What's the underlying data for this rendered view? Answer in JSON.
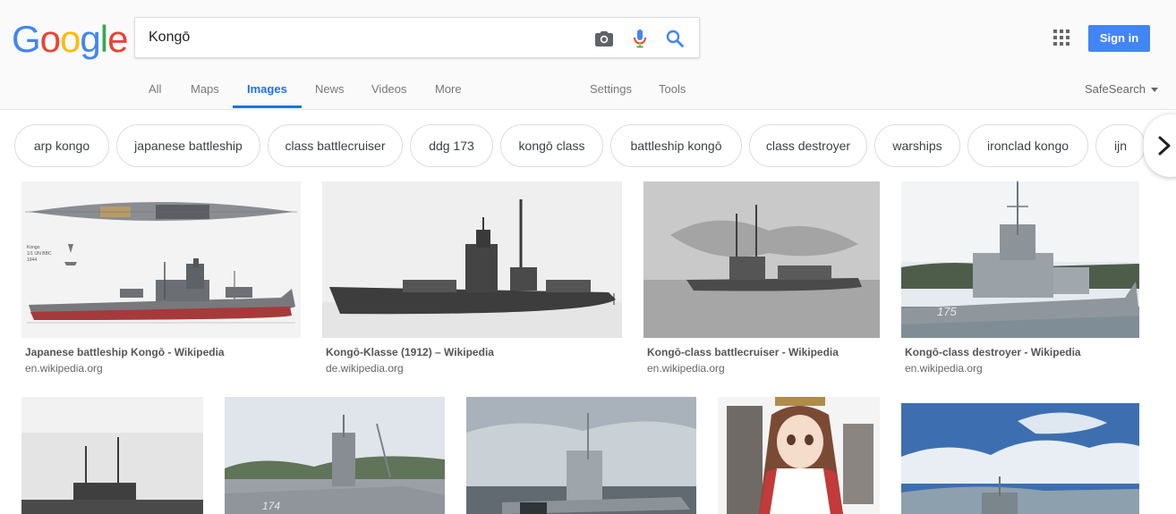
{
  "search": {
    "query": "Kongō"
  },
  "auth": {
    "sign_in_label": "Sign in"
  },
  "nav": {
    "tabs": [
      {
        "label": "All"
      },
      {
        "label": "Maps"
      },
      {
        "label": "Images"
      },
      {
        "label": "News"
      },
      {
        "label": "Videos"
      },
      {
        "label": "More"
      },
      {
        "label": "Settings"
      },
      {
        "label": "Tools"
      }
    ],
    "active_tab": "Images",
    "safesearch_label": "SafeSearch"
  },
  "chips": [
    "arp kongo",
    "japanese battleship",
    "class battlecruiser",
    "ddg 173",
    "kongō class",
    "battleship kongō",
    "class destroyer",
    "warships",
    "ironclad kongo",
    "ijn"
  ],
  "results": [
    {
      "title": "Japanese battleship Kongō - Wikipedia",
      "domain": "en.wikipedia.org"
    },
    {
      "title": "Kongō-Klasse (1912) – Wikipedia",
      "domain": "de.wikipedia.org"
    },
    {
      "title": "Kongō-class battlecruiser - Wikipedia",
      "domain": "en.wikipedia.org"
    },
    {
      "title": "Kongō-class destroyer - Wikipedia",
      "domain": "en.wikipedia.org"
    }
  ],
  "thumb_text": {
    "hull_number": "175",
    "hull_number_2": "174"
  },
  "colors": {
    "brand_blue": "#4285f4",
    "brand_red": "#ea4335",
    "brand_yellow": "#fbbc05",
    "brand_green": "#34a853",
    "active_tab": "#1a73e8"
  },
  "icons": [
    "camera-icon",
    "microphone-icon",
    "search-icon",
    "apps-grid-icon",
    "dropdown-arrow-icon",
    "chevron-right-icon"
  ]
}
